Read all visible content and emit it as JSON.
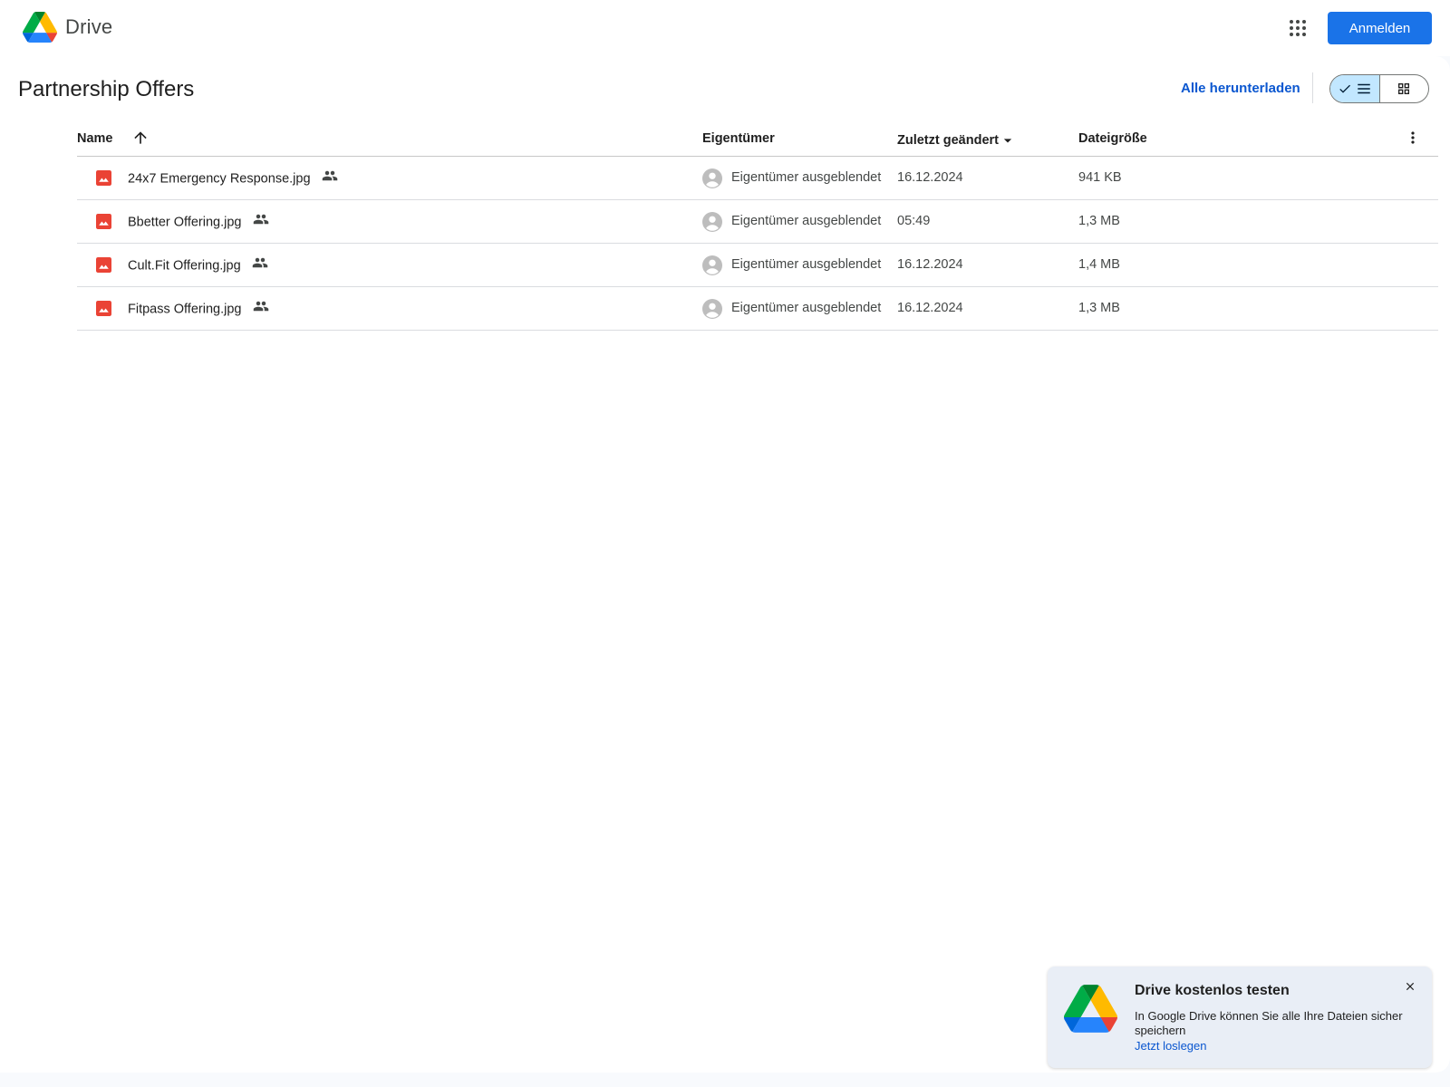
{
  "header": {
    "app_name": "Drive",
    "signin_label": "Anmelden"
  },
  "folder": {
    "title": "Partnership Offers",
    "download_all_label": "Alle herunterladen"
  },
  "table": {
    "columns": {
      "name": "Name",
      "owner": "Eigentümer",
      "modified": "Zuletzt geändert",
      "size": "Dateigröße"
    },
    "rows": [
      {
        "name": "24x7 Emergency Response.jpg",
        "owner": "Eigentümer ausgeblendet",
        "modified": "16.12.2024",
        "size": "941 KB"
      },
      {
        "name": "Bbetter Offering.jpg",
        "owner": "Eigentümer ausgeblendet",
        "modified": "05:49",
        "size": "1,3 MB"
      },
      {
        "name": "Cult.Fit Offering.jpg",
        "owner": "Eigentümer ausgeblendet",
        "modified": "16.12.2024",
        "size": "1,4 MB"
      },
      {
        "name": "Fitpass Offering.jpg",
        "owner": "Eigentümer ausgeblendet",
        "modified": "16.12.2024",
        "size": "1,3 MB"
      }
    ]
  },
  "promo": {
    "title": "Drive kostenlos testen",
    "text": "In Google Drive können Sie alle Ihre Dateien sicher speichern",
    "link": "Jetzt loslegen"
  },
  "colors": {
    "accent": "#1a73e8",
    "link": "#0b57d0",
    "image_icon": "#ea4335",
    "toggle_active": "#c2e7ff"
  },
  "icons": [
    "drive-logo-icon",
    "apps-grid-icon",
    "checkmark-icon",
    "list-view-icon",
    "grid-view-icon",
    "sort-arrow-up-icon",
    "dropdown-arrow-icon",
    "more-vert-icon",
    "image-file-icon",
    "shared-people-icon",
    "avatar-icon",
    "close-icon"
  ]
}
